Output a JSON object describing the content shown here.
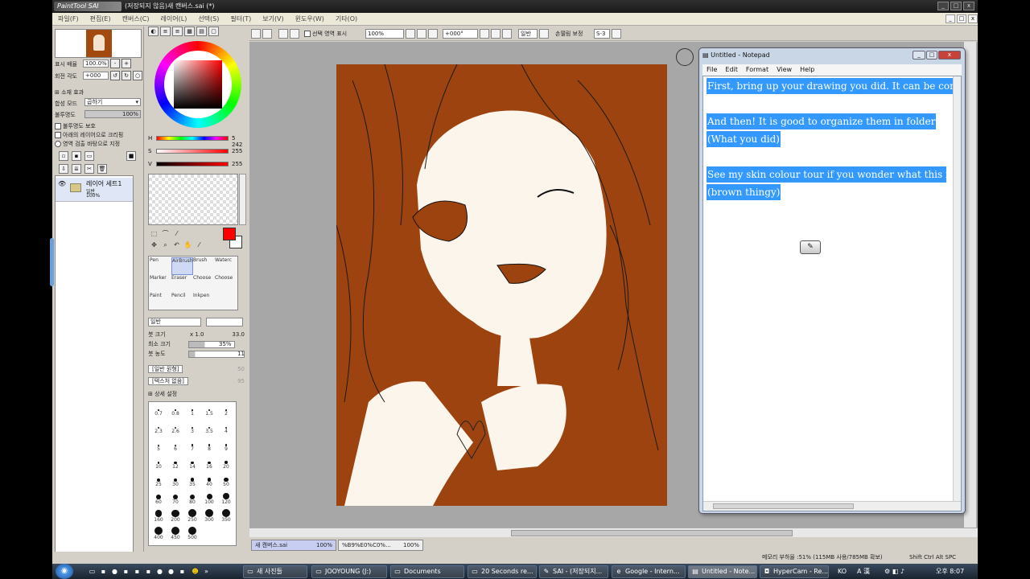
{
  "window": {
    "logo": "PaintTool SAI",
    "title": "(저장되지 않음)새 캔버스.sai (*)",
    "controls": [
      "_",
      "□",
      "x"
    ]
  },
  "menubar": [
    "파일(F)",
    "편집(E)",
    "캔버스(C)",
    "레이어(L)",
    "선택(S)",
    "필터(T)",
    "보기(V)",
    "윈도우(W)",
    "기타(O)"
  ],
  "navigator": {
    "zoom_label": "표시 배율",
    "zoom_value": "100.0%",
    "rotate_label": "회전 각도",
    "rotate_value": "+000"
  },
  "layer_panel": {
    "effects_label": "소재 효과",
    "blend_label": "합성 모드",
    "blend_value": "곱하기",
    "opacity_label": "불투명도",
    "opacity_value": "100%",
    "checks": [
      "불투명도 보호",
      "아래의 레이어으로 크리핑",
      "영역 검출 바탕으로 지정"
    ],
    "layer_name": "레이어 세트1",
    "layer_mode": "일반",
    "layer_opacity": "100%"
  },
  "color": {
    "h_label": "H",
    "h_value": "5 242",
    "s_label": "S",
    "s_value": "255",
    "v_label": "V",
    "v_value": "255",
    "foreground": "#ff0000",
    "background": "#ffffff"
  },
  "brushes": [
    {
      "label": "Pen"
    },
    {
      "label": "AirBrush"
    },
    {
      "label": "Brush"
    },
    {
      "label": "Waterc"
    },
    {
      "label": "Marker"
    },
    {
      "label": "Eraser"
    },
    {
      "label": "Choose"
    },
    {
      "label": "Choose"
    },
    {
      "label": "Paint"
    },
    {
      "label": "Pencil"
    },
    {
      "label": "Inkpen"
    }
  ],
  "brush_props": {
    "mode": "일반",
    "size_label": "붓 크기",
    "size_mult": "x 1.0",
    "size_value": "33.0",
    "min_label": "최소 크기",
    "min_value": "35%",
    "density_label": "붓 농도",
    "density_value": "11",
    "shape_label": "[일반 원형]",
    "shape_value": "50",
    "texture_label": "[텍스처 없음]",
    "texture_value": "95",
    "detail_label": "상세 설정"
  },
  "brush_sizes": [
    "0.7",
    "0.8",
    "1",
    "1.5",
    "2",
    "2.3",
    "2.6",
    "3",
    "3.5",
    "4",
    "5",
    "6",
    "7",
    "8",
    "9",
    "10",
    "12",
    "14",
    "16",
    "20",
    "25",
    "30",
    "35",
    "40",
    "50",
    "60",
    "70",
    "80",
    "100",
    "120",
    "160",
    "200",
    "250",
    "300",
    "350",
    "400",
    "450",
    "500"
  ],
  "toolbar": {
    "selection_label": "선택 영역 표시",
    "zoom": "100%",
    "angle": "+000°",
    "mode": "일반",
    "stabilizer_label": "손떨림 보정",
    "stabilizer_value": "S-3"
  },
  "doc_tabs": [
    {
      "label": "새 캔버스.sai",
      "pct": "100%"
    },
    {
      "label": "%B9%E0%C0%...",
      "pct": "100%"
    }
  ],
  "status": "메모리 부하율 :51% (115MB 사용/785MB 확보)",
  "status_keys": "Shift Ctrl Alt SPC",
  "notepad": {
    "title": "Untitled - Notepad",
    "menu": [
      "File",
      "Edit",
      "Format",
      "View",
      "Help"
    ],
    "lines": [
      "First, bring up your drawing you did. It can be com",
      "And then! It is good to organize them in folder",
      "(What you did)",
      "See my skin colour tour if you wonder what this is",
      "(brown thingy)"
    ],
    "highlight": "#3399ff"
  },
  "taskbar": {
    "tasks": [
      {
        "label": "새 사진들",
        "icon": "folder-icon"
      },
      {
        "label": "JOOYOUNG (J:)",
        "icon": "drive-icon"
      },
      {
        "label": "Documents",
        "icon": "folder-icon"
      },
      {
        "label": "20 Seconds re...",
        "icon": "folder-icon"
      },
      {
        "label": "SAI - (저장되지...",
        "icon": "sai-icon"
      },
      {
        "label": "Google - Intern...",
        "icon": "ie-icon"
      },
      {
        "label": "Untitled - Note...",
        "icon": "notepad-icon"
      },
      {
        "label": "HyperCam - Re...",
        "icon": "camera-icon"
      }
    ],
    "lang": "KO",
    "ime": "A 漢",
    "clock": "오후 8:07"
  }
}
